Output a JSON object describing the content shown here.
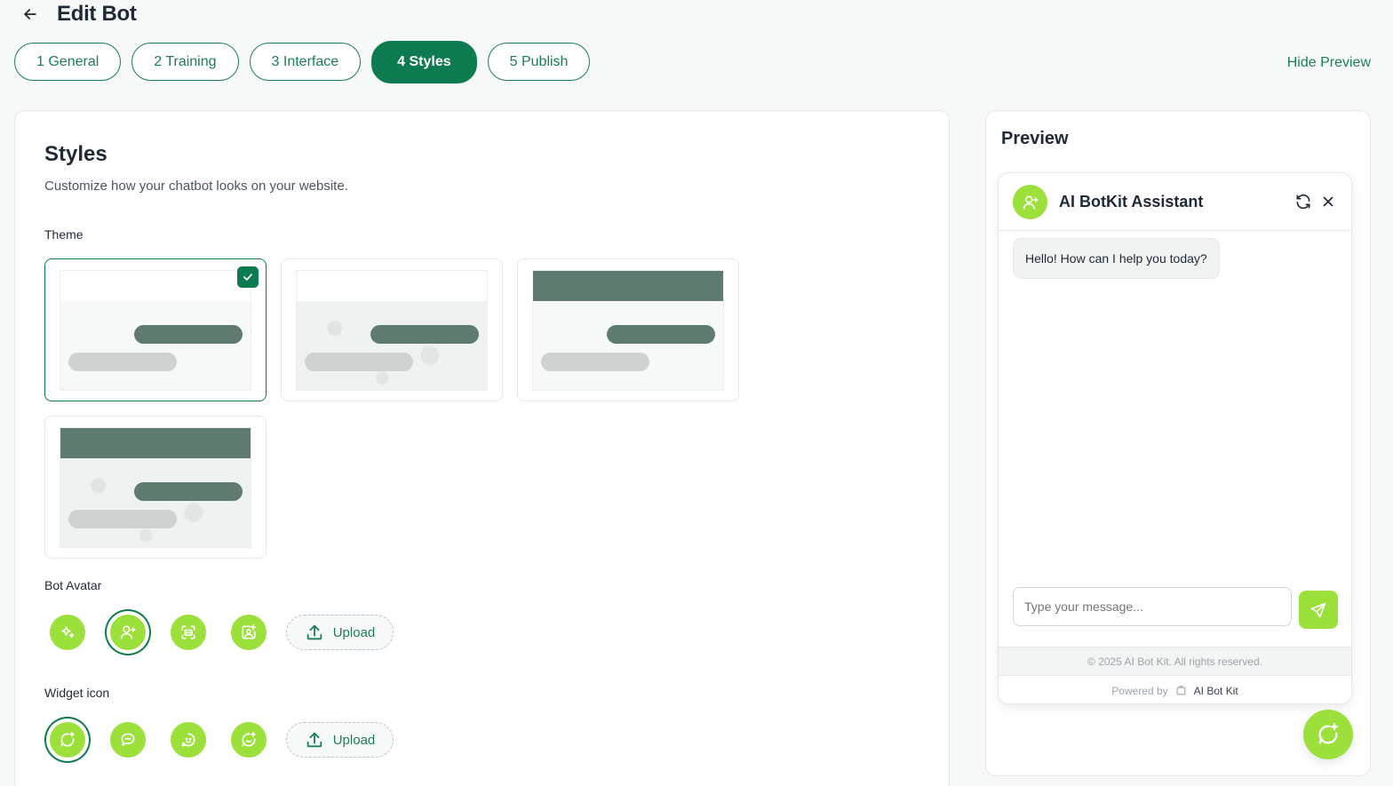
{
  "header": {
    "title": "Edit Bot",
    "back_icon": "arrow-left-icon"
  },
  "steps": [
    {
      "label": "1 General",
      "active": false
    },
    {
      "label": "2 Training",
      "active": false
    },
    {
      "label": "3 Interface",
      "active": false
    },
    {
      "label": "4 Styles",
      "active": true
    },
    {
      "label": "5 Publish",
      "active": false
    }
  ],
  "hide_preview_label": "Hide Preview",
  "styles": {
    "title": "Styles",
    "subtitle": "Customize how your chatbot looks on your website.",
    "theme_label": "Theme",
    "themes": [
      {
        "header": "light",
        "background": "plain",
        "selected": true
      },
      {
        "header": "light",
        "background": "pattern",
        "selected": false
      },
      {
        "header": "dark",
        "background": "plain",
        "selected": false
      },
      {
        "header": "dark",
        "background": "pattern",
        "selected": false
      }
    ],
    "bot_avatar_label": "Bot Avatar",
    "bot_avatars": [
      {
        "icon": "sparkles-icon",
        "selected": false
      },
      {
        "icon": "user-plus-icon",
        "selected": true
      },
      {
        "icon": "bot-face-icon",
        "selected": false
      },
      {
        "icon": "image-sparkle-icon",
        "selected": false
      }
    ],
    "widget_icon_label": "Widget icon",
    "widget_icons": [
      {
        "icon": "chat-sparkle-icon",
        "selected": true
      },
      {
        "icon": "chat-bubble-icon",
        "selected": false
      },
      {
        "icon": "chat-smile-icon",
        "selected": false
      },
      {
        "icon": "chat-plus-icon",
        "selected": false
      }
    ],
    "upload_label": "Upload"
  },
  "preview": {
    "title": "Preview",
    "bot_name": "AI BotKit Assistant",
    "greeting": "Hello! How can I help you today?",
    "input_placeholder": "Type your message...",
    "copyright": "© 2025 AI Bot Kit. All rights reserved.",
    "powered_by": "Powered by",
    "brand": "AI Bot Kit"
  },
  "colors": {
    "primary": "#0e7a4f",
    "accent": "#9be03b",
    "theme_dark": "#5f7a6e",
    "bubble_gray": "#cfd2d1"
  }
}
